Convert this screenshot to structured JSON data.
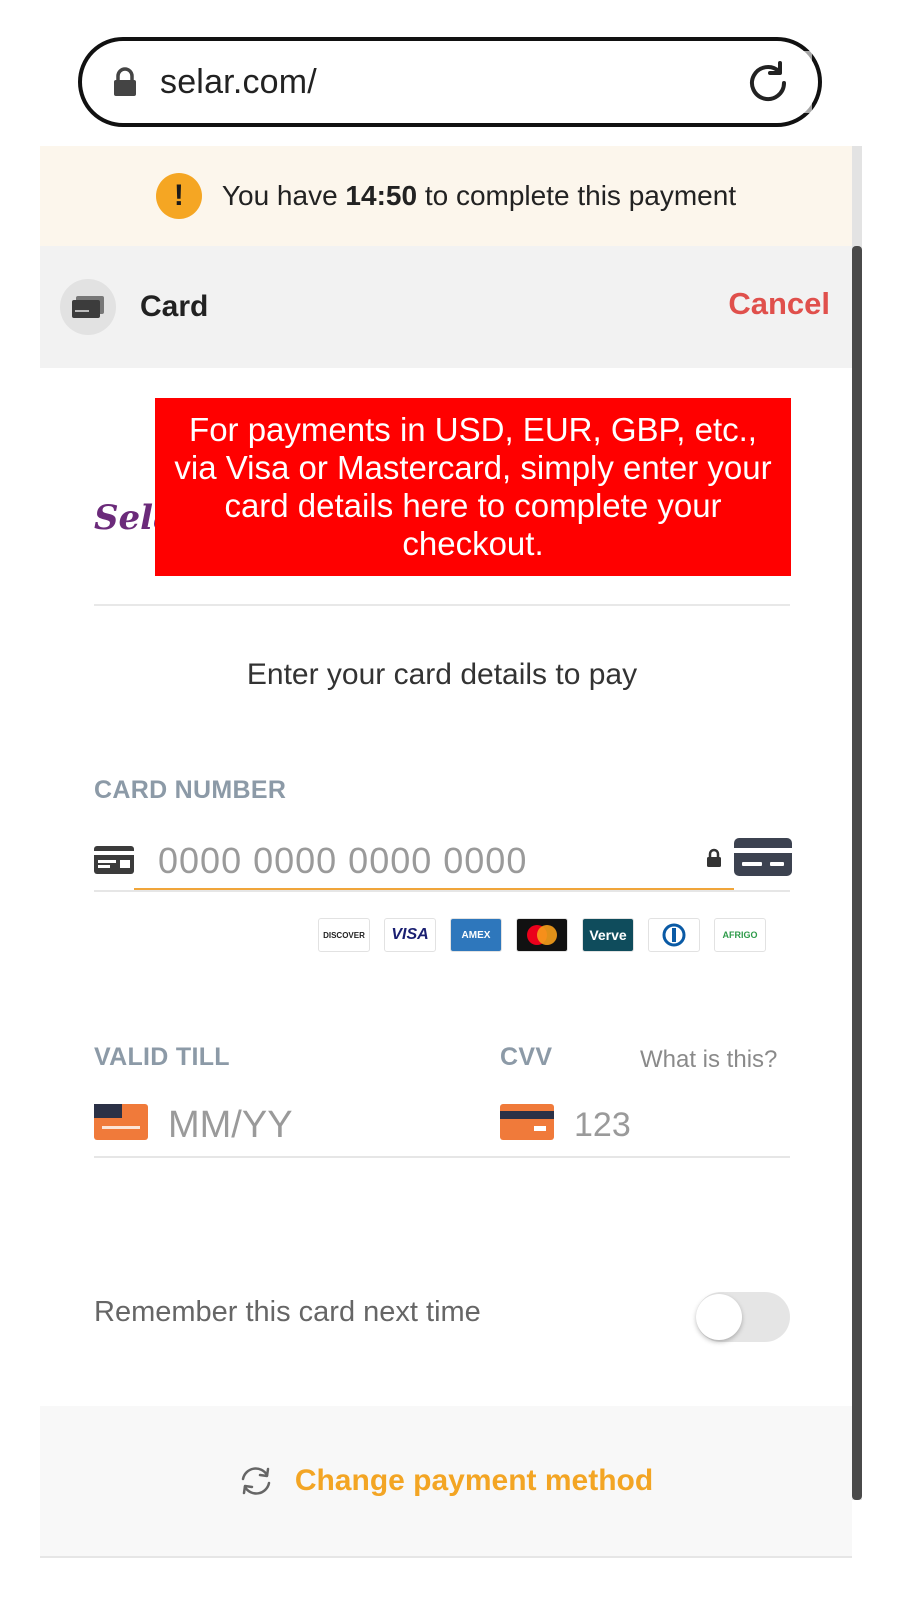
{
  "browser": {
    "url_text": "selar.com/",
    "icons": {
      "lock": "lock-icon",
      "reload": "reload-icon"
    }
  },
  "timer": {
    "prefix": "You have",
    "time": "14:50",
    "suffix": "to complete this payment",
    "icon": "!",
    "color": "#f5a623"
  },
  "method": {
    "title": "Card",
    "cancel_label": "Cancel",
    "cancel_color": "#e0504c"
  },
  "merchant": {
    "logo_text": "Selar"
  },
  "promo": {
    "text": "For payments in USD, EUR, GBP, etc., via Visa or Mastercard, simply enter your card details here to complete your checkout."
  },
  "form": {
    "instruction": "Enter your card details to pay",
    "card_number": {
      "label": "CARD NUMBER",
      "placeholder": "0000 0000 0000 0000",
      "value": ""
    },
    "brands": [
      "DISCOVER",
      "VISA",
      "AMEX",
      "Mastercard",
      "Verve",
      "Diners",
      "AFRIGO"
    ],
    "valid_till": {
      "label": "VALID TILL",
      "placeholder": "MM/YY",
      "value": ""
    },
    "cvv": {
      "label": "CVV",
      "placeholder": "123",
      "value": "",
      "help_label": "What is this?"
    },
    "remember": {
      "label": "Remember this card next time",
      "enabled": false
    }
  },
  "footer": {
    "change_label": "Change payment method",
    "accent_color": "#f3a524"
  }
}
